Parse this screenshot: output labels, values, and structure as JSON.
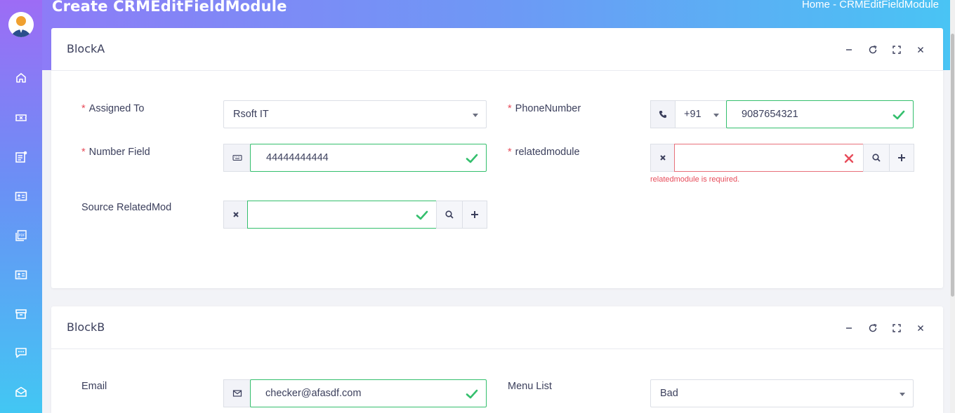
{
  "header": {
    "title": "Create CRMEditFieldModule",
    "breadcrumb": "Home  -  CRMEditFieldModule"
  },
  "sidebar": {
    "items": [
      {
        "icon": "home-icon"
      },
      {
        "icon": "ticket-icon"
      },
      {
        "icon": "notes-icon"
      },
      {
        "icon": "contact-card-icon"
      },
      {
        "icon": "pdf-icon"
      },
      {
        "icon": "id-card-icon"
      },
      {
        "icon": "archive-icon"
      },
      {
        "icon": "chat-icon"
      },
      {
        "icon": "mail-icon"
      }
    ]
  },
  "blockA": {
    "title": "BlockA",
    "assigned_to": {
      "label": "Assigned To",
      "value": "Rsoft IT"
    },
    "phone": {
      "label": "PhoneNumber",
      "code": "+91",
      "value": "9087654321"
    },
    "number_field": {
      "label": "Number Field",
      "value": "44444444444"
    },
    "related_module": {
      "label": "relatedmodule",
      "value": "",
      "error": "relatedmodule is required."
    },
    "source_related": {
      "label": "Source RelatedMod",
      "value": ""
    }
  },
  "blockB": {
    "title": "BlockB",
    "email": {
      "label": "Email",
      "value": "checker@afasdf.com"
    },
    "menu_list": {
      "label": "Menu List",
      "value": "Bad"
    }
  },
  "colors": {
    "valid": "#34bf6d",
    "error": "#e74c5a",
    "text": "#3b3f5c"
  }
}
